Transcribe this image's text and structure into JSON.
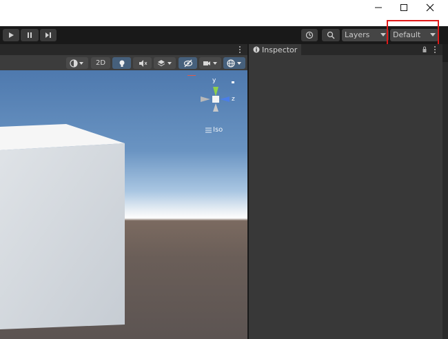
{
  "toolbar": {
    "play_icon": "play-icon",
    "pause_icon": "pause-icon",
    "step_icon": "step-icon",
    "history_icon": "history-icon",
    "search_icon": "search-icon",
    "layers_label": "Layers",
    "layout_label": "Default"
  },
  "scene": {
    "mode_2d_label": "2D",
    "gizmo": {
      "y_label": "y",
      "z_label": "z",
      "projection_label": "Iso"
    }
  },
  "inspector": {
    "tab_label": "Inspector"
  },
  "colors": {
    "highlight": "#e01818",
    "gizmo_y": "#8fd14a",
    "gizmo_z": "#4a7ee8",
    "toolbar_bg": "#191919",
    "panel_bg": "#383838"
  }
}
